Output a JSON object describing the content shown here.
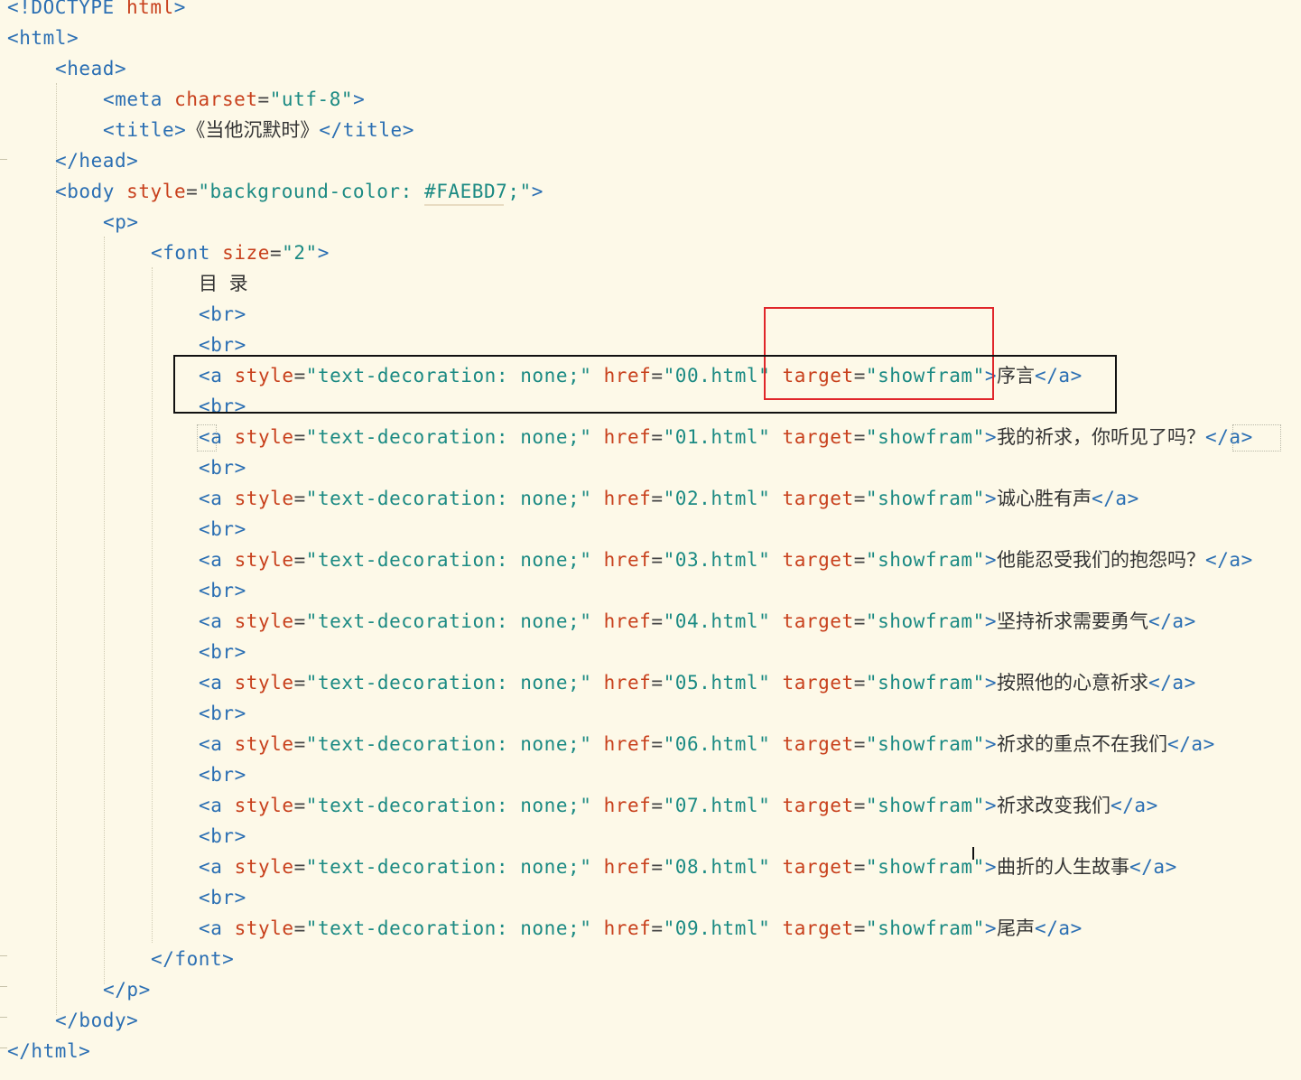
{
  "editor": {
    "lines": [
      {
        "indent": 0,
        "tokens": [
          [
            "t",
            "<!DOCTYPE "
          ],
          [
            "at",
            "html"
          ],
          [
            "t",
            ">"
          ]
        ]
      },
      {
        "indent": 0,
        "tokens": [
          [
            "t",
            "<html>"
          ]
        ]
      },
      {
        "indent": 1,
        "tokens": [
          [
            "t",
            "<head>"
          ]
        ]
      },
      {
        "indent": 2,
        "tokens": [
          [
            "t",
            "<meta "
          ],
          [
            "at",
            "charset"
          ],
          [
            "p",
            "="
          ],
          [
            "v",
            "\"utf-8\""
          ],
          [
            "t",
            ">"
          ]
        ]
      },
      {
        "indent": 2,
        "tokens": [
          [
            "t",
            "<title>"
          ],
          [
            "ch",
            "《当他沉默时》"
          ],
          [
            "t",
            "</title>"
          ]
        ]
      },
      {
        "indent": 1,
        "tokens": [
          [
            "t",
            "</head>"
          ]
        ]
      },
      {
        "indent": 1,
        "tokens": [
          [
            "t",
            "<body "
          ],
          [
            "at",
            "style"
          ],
          [
            "p",
            "="
          ],
          [
            "v",
            "\"background-color: #FAEBD7;\""
          ],
          [
            "t",
            ">"
          ]
        ]
      },
      {
        "indent": 2,
        "tokens": [
          [
            "t",
            "<p>"
          ]
        ]
      },
      {
        "indent": 3,
        "tokens": [
          [
            "t",
            "<font "
          ],
          [
            "at",
            "size"
          ],
          [
            "p",
            "="
          ],
          [
            "v",
            "\"2\""
          ],
          [
            "t",
            ">"
          ]
        ]
      },
      {
        "indent": 4,
        "tokens": [
          [
            "ch",
            "目 录"
          ]
        ]
      },
      {
        "indent": 4,
        "tokens": [
          [
            "t",
            "<br>"
          ]
        ]
      },
      {
        "indent": 4,
        "tokens": [
          [
            "t",
            "<br>"
          ]
        ]
      },
      {
        "indent": 4,
        "tokens": [
          [
            "t",
            "<a "
          ],
          [
            "at",
            "style"
          ],
          [
            "p",
            "="
          ],
          [
            "v",
            "\"text-decoration: none;\" "
          ],
          [
            "at",
            "href"
          ],
          [
            "p",
            "="
          ],
          [
            "v",
            "\"00.html\" "
          ],
          [
            "at",
            "target"
          ],
          [
            "p",
            "="
          ],
          [
            "v",
            "\"showfram\""
          ],
          [
            "t",
            ">"
          ],
          [
            "ch",
            "序言"
          ],
          [
            "t",
            "</a>"
          ]
        ]
      },
      {
        "indent": 4,
        "tokens": [
          [
            "t",
            "<br>"
          ]
        ]
      },
      {
        "indent": 4,
        "tokens": [
          [
            "t",
            "<a "
          ],
          [
            "at",
            "style"
          ],
          [
            "p",
            "="
          ],
          [
            "v",
            "\"text-decoration: none;\" "
          ],
          [
            "at",
            "href"
          ],
          [
            "p",
            "="
          ],
          [
            "v",
            "\"01.html\" "
          ],
          [
            "at",
            "target"
          ],
          [
            "p",
            "="
          ],
          [
            "v",
            "\"showfram\""
          ],
          [
            "t",
            ">"
          ],
          [
            "ch",
            "我的祈求，你听见了吗？"
          ],
          [
            "t",
            "</a>"
          ]
        ]
      },
      {
        "indent": 4,
        "tokens": [
          [
            "t",
            "<br>"
          ]
        ]
      },
      {
        "indent": 4,
        "tokens": [
          [
            "t",
            "<a "
          ],
          [
            "at",
            "style"
          ],
          [
            "p",
            "="
          ],
          [
            "v",
            "\"text-decoration: none;\" "
          ],
          [
            "at",
            "href"
          ],
          [
            "p",
            "="
          ],
          [
            "v",
            "\"02.html\" "
          ],
          [
            "at",
            "target"
          ],
          [
            "p",
            "="
          ],
          [
            "v",
            "\"showfram\""
          ],
          [
            "t",
            ">"
          ],
          [
            "ch",
            "诚心胜有声"
          ],
          [
            "t",
            "</a>"
          ]
        ]
      },
      {
        "indent": 4,
        "tokens": [
          [
            "t",
            "<br>"
          ]
        ]
      },
      {
        "indent": 4,
        "tokens": [
          [
            "t",
            "<a "
          ],
          [
            "at",
            "style"
          ],
          [
            "p",
            "="
          ],
          [
            "v",
            "\"text-decoration: none;\" "
          ],
          [
            "at",
            "href"
          ],
          [
            "p",
            "="
          ],
          [
            "v",
            "\"03.html\" "
          ],
          [
            "at",
            "target"
          ],
          [
            "p",
            "="
          ],
          [
            "v",
            "\"showfram\""
          ],
          [
            "t",
            ">"
          ],
          [
            "ch",
            "他能忍受我们的抱怨吗？"
          ],
          [
            "t",
            "</a>"
          ]
        ]
      },
      {
        "indent": 4,
        "tokens": [
          [
            "t",
            "<br>"
          ]
        ]
      },
      {
        "indent": 4,
        "tokens": [
          [
            "t",
            "<a "
          ],
          [
            "at",
            "style"
          ],
          [
            "p",
            "="
          ],
          [
            "v",
            "\"text-decoration: none;\" "
          ],
          [
            "at",
            "href"
          ],
          [
            "p",
            "="
          ],
          [
            "v",
            "\"04.html\" "
          ],
          [
            "at",
            "target"
          ],
          [
            "p",
            "="
          ],
          [
            "v",
            "\"showfram\""
          ],
          [
            "t",
            ">"
          ],
          [
            "ch",
            "坚持祈求需要勇气"
          ],
          [
            "t",
            "</a>"
          ]
        ]
      },
      {
        "indent": 4,
        "tokens": [
          [
            "t",
            "<br>"
          ]
        ]
      },
      {
        "indent": 4,
        "tokens": [
          [
            "t",
            "<a "
          ],
          [
            "at",
            "style"
          ],
          [
            "p",
            "="
          ],
          [
            "v",
            "\"text-decoration: none;\" "
          ],
          [
            "at",
            "href"
          ],
          [
            "p",
            "="
          ],
          [
            "v",
            "\"05.html\" "
          ],
          [
            "at",
            "target"
          ],
          [
            "p",
            "="
          ],
          [
            "v",
            "\"showfram\""
          ],
          [
            "t",
            ">"
          ],
          [
            "ch",
            "按照他的心意祈求"
          ],
          [
            "t",
            "</a>"
          ]
        ]
      },
      {
        "indent": 4,
        "tokens": [
          [
            "t",
            "<br>"
          ]
        ]
      },
      {
        "indent": 4,
        "tokens": [
          [
            "t",
            "<a "
          ],
          [
            "at",
            "style"
          ],
          [
            "p",
            "="
          ],
          [
            "v",
            "\"text-decoration: none;\" "
          ],
          [
            "at",
            "href"
          ],
          [
            "p",
            "="
          ],
          [
            "v",
            "\"06.html\" "
          ],
          [
            "at",
            "target"
          ],
          [
            "p",
            "="
          ],
          [
            "v",
            "\"showfram\""
          ],
          [
            "t",
            ">"
          ],
          [
            "ch",
            "祈求的重点不在我们"
          ],
          [
            "t",
            "</a>"
          ]
        ]
      },
      {
        "indent": 4,
        "tokens": [
          [
            "t",
            "<br>"
          ]
        ]
      },
      {
        "indent": 4,
        "tokens": [
          [
            "t",
            "<a "
          ],
          [
            "at",
            "style"
          ],
          [
            "p",
            "="
          ],
          [
            "v",
            "\"text-decoration: none;\" "
          ],
          [
            "at",
            "href"
          ],
          [
            "p",
            "="
          ],
          [
            "v",
            "\"07.html\" "
          ],
          [
            "at",
            "target"
          ],
          [
            "p",
            "="
          ],
          [
            "v",
            "\"showfram\""
          ],
          [
            "t",
            ">"
          ],
          [
            "ch",
            "祈求改变我们"
          ],
          [
            "t",
            "</a>"
          ]
        ]
      },
      {
        "indent": 4,
        "tokens": [
          [
            "t",
            "<br>"
          ]
        ]
      },
      {
        "indent": 4,
        "tokens": [
          [
            "t",
            "<a "
          ],
          [
            "at",
            "style"
          ],
          [
            "p",
            "="
          ],
          [
            "v",
            "\"text-decoration: none;\" "
          ],
          [
            "at",
            "href"
          ],
          [
            "p",
            "="
          ],
          [
            "v",
            "\"08.html\" "
          ],
          [
            "at",
            "target"
          ],
          [
            "p",
            "="
          ],
          [
            "v",
            "\"showfram\""
          ],
          [
            "t",
            ">"
          ],
          [
            "ch",
            "曲折的人生故事"
          ],
          [
            "t",
            "</a>"
          ]
        ]
      },
      {
        "indent": 4,
        "tokens": [
          [
            "t",
            "<br>"
          ]
        ]
      },
      {
        "indent": 4,
        "tokens": [
          [
            "t",
            "<a "
          ],
          [
            "at",
            "style"
          ],
          [
            "p",
            "="
          ],
          [
            "v",
            "\"text-decoration: none;\" "
          ],
          [
            "at",
            "href"
          ],
          [
            "p",
            "="
          ],
          [
            "v",
            "\"09.html\" "
          ],
          [
            "at",
            "target"
          ],
          [
            "p",
            "="
          ],
          [
            "v",
            "\"showfram\""
          ],
          [
            "t",
            ">"
          ],
          [
            "ch",
            "尾声"
          ],
          [
            "t",
            "</a>"
          ]
        ]
      },
      {
        "indent": 3,
        "tokens": [
          [
            "t",
            "</font>"
          ]
        ]
      },
      {
        "indent": 2,
        "tokens": [
          [
            "t",
            "</p>"
          ]
        ]
      },
      {
        "indent": 1,
        "tokens": [
          [
            "t",
            "</body>"
          ]
        ]
      },
      {
        "indent": 0,
        "tokens": [
          [
            "t",
            "</html>"
          ]
        ]
      }
    ]
  }
}
